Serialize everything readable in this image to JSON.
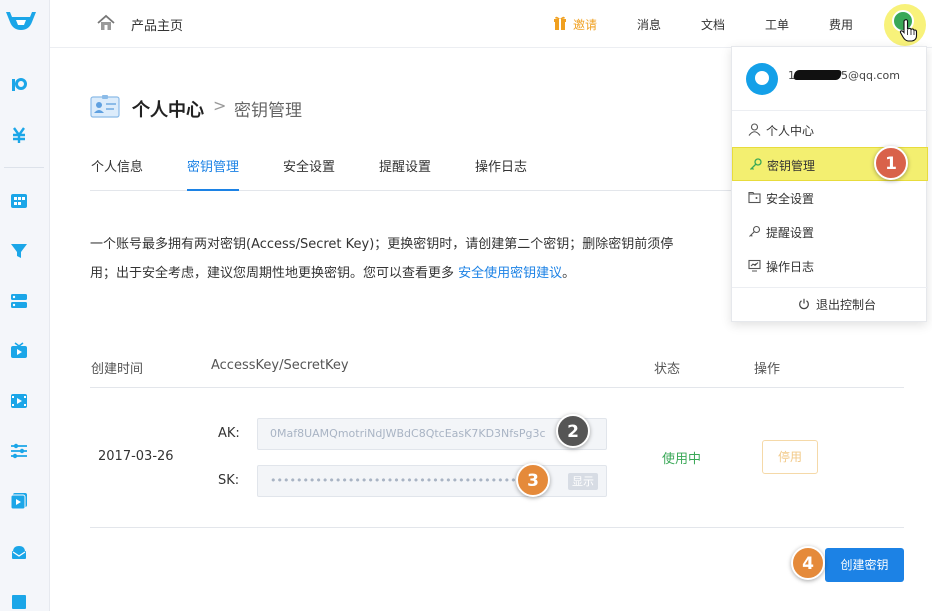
{
  "topbar": {
    "home_label": "产品主页",
    "invite_label": "邀请",
    "nav": [
      "消息",
      "文档",
      "工单",
      "费用"
    ]
  },
  "page": {
    "title": "个人中心",
    "separator": ">",
    "current": "密钥管理"
  },
  "tabs": [
    {
      "label": "个人信息",
      "active": false
    },
    {
      "label": "密钥管理",
      "active": true
    },
    {
      "label": "安全设置",
      "active": false
    },
    {
      "label": "提醒设置",
      "active": false
    },
    {
      "label": "操作日志",
      "active": false
    }
  ],
  "description": {
    "line1": "一个账号最多拥有两对密钥(Access/Secret Key)；更换密钥时，请创建第二个密钥；删除密钥前须停",
    "line2": "用；出于安全考虑，建议您周期性地更换密钥。您可以查看更多 ",
    "link": "安全使用密钥建议",
    "line2_end": "。"
  },
  "table": {
    "headers": [
      "创建时间",
      "AccessKey/SecretKey",
      "状态",
      "操作"
    ],
    "rows": [
      {
        "created": "2017-03-26",
        "ak_label": "AK:",
        "ak_value": "0Maf8UAMQmotriNdJWBdC8QtcEasK7KD3NfsPg3c",
        "sk_label": "SK:",
        "sk_value": "••••••••••••••••••••••••••••••••••••••••",
        "show_label": "显示",
        "status": "使用中",
        "action": "停用"
      }
    ]
  },
  "create_button": "创建密钥",
  "dropdown": {
    "email": "1",
    "email_suffix": "5@qq.com",
    "items": [
      "个人中心",
      "密钥管理",
      "安全设置",
      "提醒设置",
      "操作日志"
    ],
    "highlighted": "密钥管理",
    "logout": "退出控制台"
  },
  "badges": [
    "1",
    "2",
    "3",
    "4"
  ],
  "colors": {
    "accent": "#1c82e5",
    "invite": "#f0a020",
    "status_ok": "#3aa857",
    "badge_red": "#d9624a",
    "badge_gray": "#555555",
    "badge_orange": "#e58a3a",
    "highlight": "#f3ef70"
  }
}
